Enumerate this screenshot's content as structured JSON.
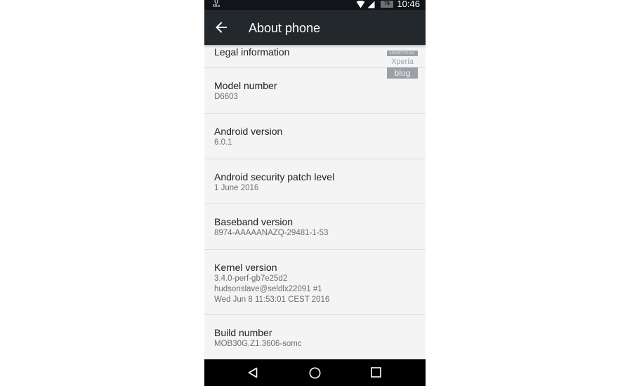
{
  "status_bar": {
    "net_speed_value": "0",
    "net_speed_unit": "KB/s",
    "battery_level": "78",
    "time": "10:46",
    "icons": [
      "wifi-icon",
      "signal-icon",
      "battery-icon"
    ]
  },
  "app_bar": {
    "title": "About phone",
    "back_icon": "arrow-left-icon"
  },
  "watermark": {
    "top": "UNOFFICIAL",
    "middle": "Xperia",
    "bottom": "blog"
  },
  "items": [
    {
      "title": "Legal information"
    },
    {
      "title": "Model number",
      "summary": [
        "D6603"
      ]
    },
    {
      "title": "Android version",
      "summary": [
        "6.0.1"
      ]
    },
    {
      "title": "Android security patch level",
      "summary": [
        "1 June 2016"
      ]
    },
    {
      "title": "Baseband version",
      "summary": [
        "8974-AAAAANAZQ-29481-1-53"
      ]
    },
    {
      "title": "Kernel version",
      "summary": [
        "3.4.0-perf-gb7e25d2",
        "hudsonslave@seldlx22091 #1",
        "Wed Jun 8 11:53:01 CEST 2016"
      ]
    },
    {
      "title": "Build number",
      "summary": [
        "MOB30G.Z1.3606-somc"
      ]
    }
  ],
  "nav_bar": {
    "buttons": [
      "back-triangle-icon",
      "home-circle-icon",
      "recents-square-icon"
    ]
  }
}
